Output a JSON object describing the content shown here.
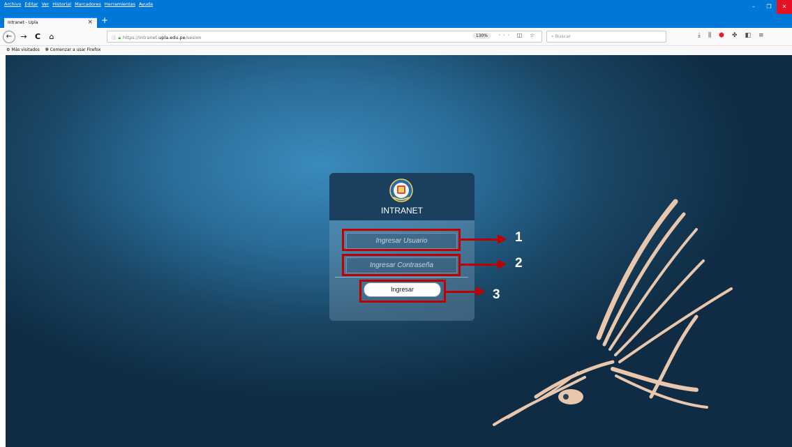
{
  "browser": {
    "menu": [
      "Archivo",
      "Editar",
      "Ver",
      "Historial",
      "Marcadores",
      "Herramientas",
      "Ayuda"
    ],
    "window_controls": {
      "minimize": "–",
      "maximize": "❐",
      "close": "✕"
    },
    "tab": {
      "title": "Intranet - Upla",
      "close": "×"
    },
    "new_tab": "+",
    "nav": {
      "back": "←",
      "forward": "→",
      "reload": "C",
      "home": "⌂"
    },
    "url": {
      "prefix": "https://intranet.",
      "domain": "upla.edu.pe",
      "path": "/sesion",
      "zoom": "130%",
      "page_actions": "··· ◫ ☆"
    },
    "search_placeholder": "Buscar",
    "toolbar_icons": [
      "download-icon",
      "library-icon",
      "ublock-icon",
      "extension-icon",
      "sidebar-icon",
      "menu-icon"
    ],
    "bookmarks": [
      "Más visitados",
      "Comenzar a usar Firefox"
    ]
  },
  "login": {
    "title": "INTRANET",
    "username_placeholder": "Ingresar Usuario",
    "password_placeholder": "Ingresar Contraseña",
    "submit_label": "Ingresar"
  },
  "annotations": {
    "labels": [
      "1",
      "2",
      "3"
    ],
    "color": "#c00000"
  },
  "colors": {
    "titlebar": "#0078d7",
    "header": "#1b3f5f",
    "condor": "#e8c7ad"
  }
}
